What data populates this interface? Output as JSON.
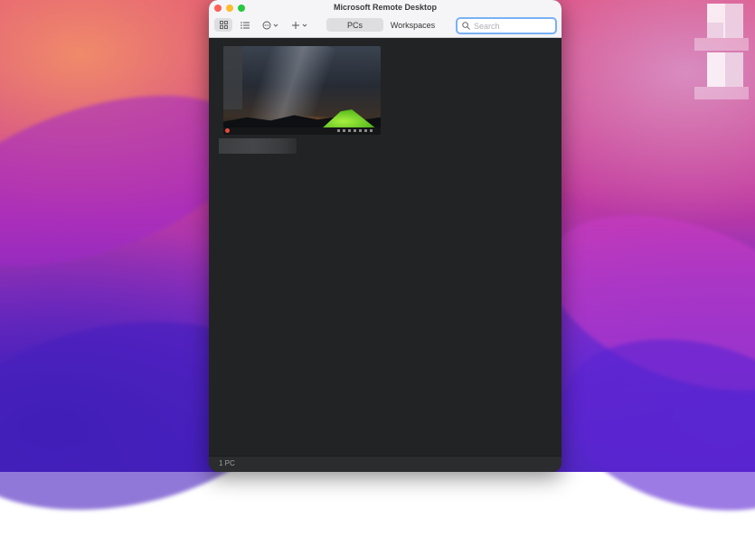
{
  "window": {
    "title": "Microsoft Remote Desktop"
  },
  "toolbar": {
    "tabs": [
      {
        "label": "PCs",
        "selected": true
      },
      {
        "label": "Workspaces",
        "selected": false
      }
    ],
    "search_placeholder": "Search",
    "icons": {
      "grid_view": "grid-icon",
      "list_view": "list-icon",
      "more": "ellipsis-circle-icon",
      "add": "plus-icon",
      "search": "magnifier-icon"
    }
  },
  "pcs": [
    {
      "name": "",
      "thumbnail": "tent-under-milky-way-wallpaper"
    }
  ],
  "status": {
    "count": "1 PC"
  },
  "colors": {
    "accent": "#7ab0f5",
    "close": "#fe5f57",
    "minimize": "#febc2e",
    "maximize": "#28c840"
  }
}
